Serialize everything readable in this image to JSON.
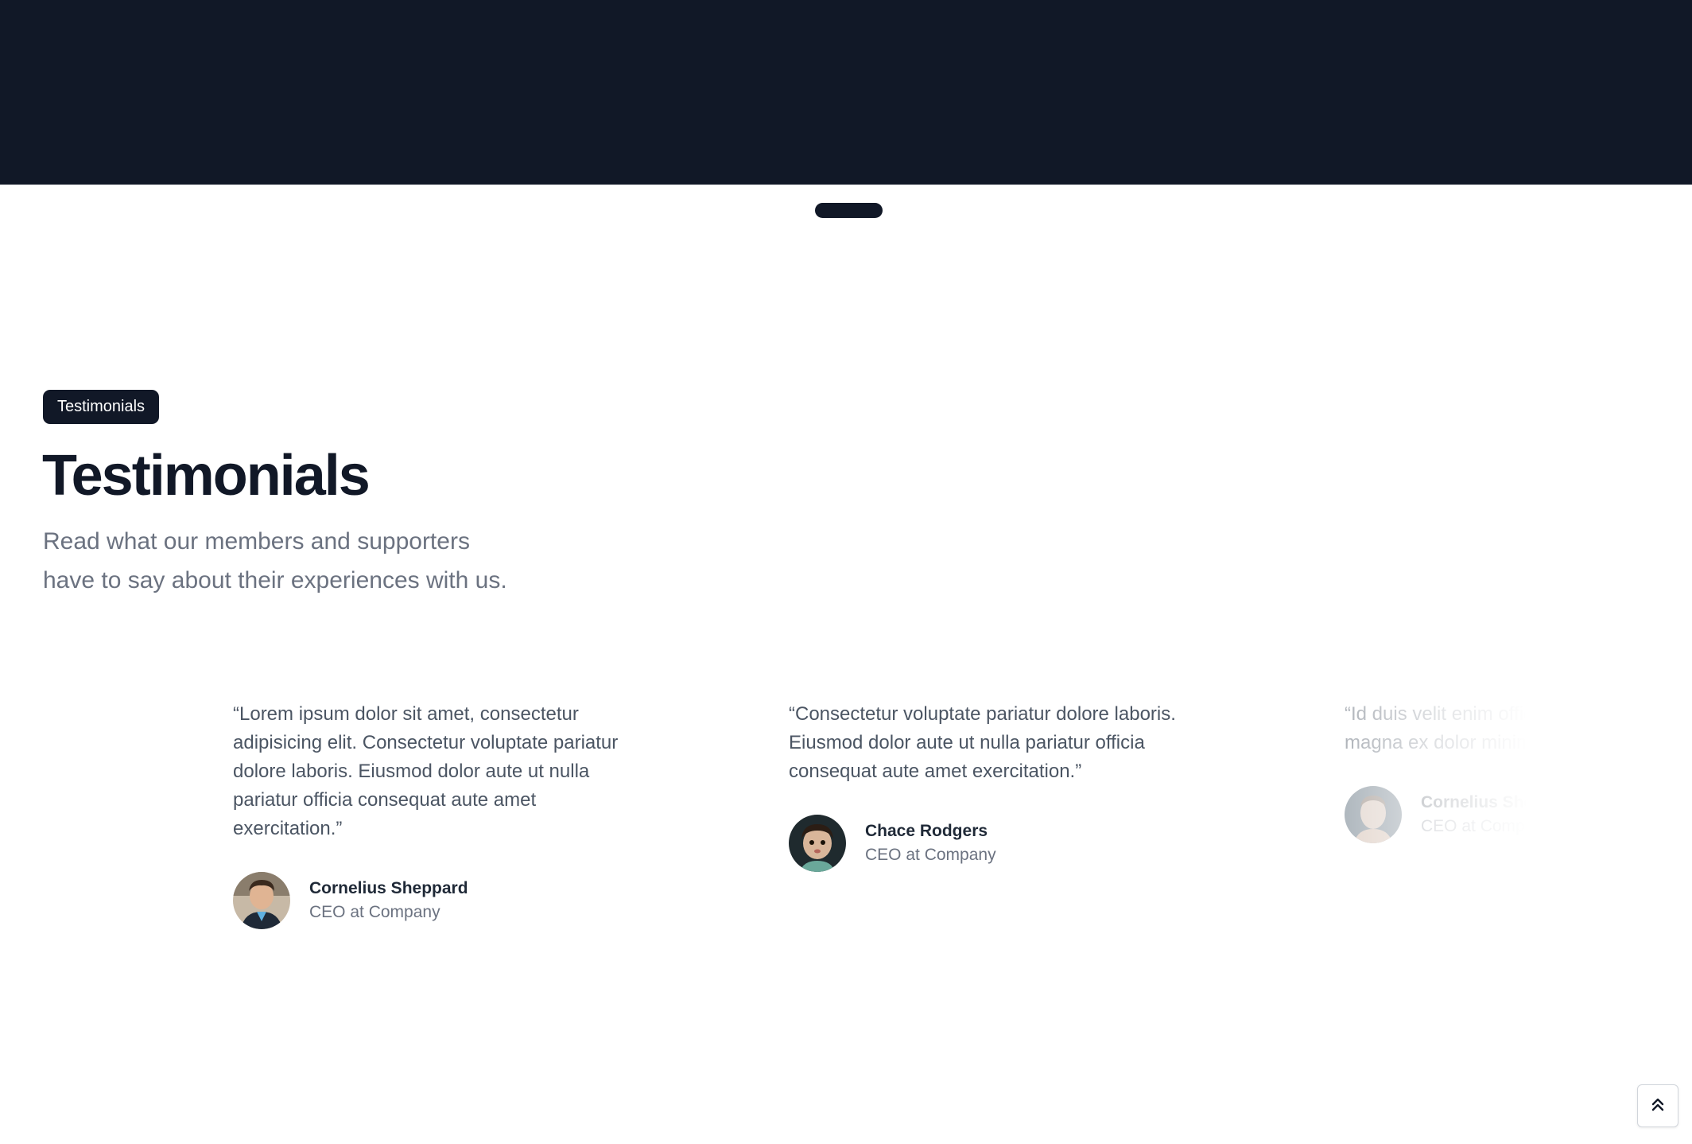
{
  "hero": {
    "background_color": "#111827"
  },
  "slider": {
    "indicator_color": "#111827"
  },
  "testimonials": {
    "badge": "Testimonials",
    "title": "Testimonials",
    "subtitle_line1": "Read what our members and supporters",
    "subtitle_line2": "have to say about their experiences with us.",
    "items": [
      {
        "quote": "“Lorem ipsum dolor sit amet, consectetur adipisicing elit. Consectetur voluptate pariatur dolore laboris. Eiusmod dolor aute ut nulla pariatur officia consequat aute amet exercitation.”",
        "name": "Cornelius Sheppard",
        "role": "CEO at Company",
        "avatar_icon": "person-avatar"
      },
      {
        "quote": "“Consectetur voluptate pariatur dolore laboris. Eiusmod dolor aute ut nulla pariatur officia consequat aute amet exercitation.”",
        "name": "Chace Rodgers",
        "role": "CEO at Company",
        "avatar_icon": "person-avatar"
      },
      {
        "quote_line1": "“Id duis velit enim officia ad nisi",
        "quote_line2": "magna ex dolor minim deserunt",
        "name": "Cornelius Sheppard",
        "role": "CEO at Company",
        "avatar_icon": "person-avatar"
      }
    ]
  },
  "scroll_top": {
    "icon": "double-chevron-up-icon"
  },
  "colors": {
    "dark": "#111827",
    "muted_text": "#6b7280",
    "body_text": "#4b5563"
  }
}
